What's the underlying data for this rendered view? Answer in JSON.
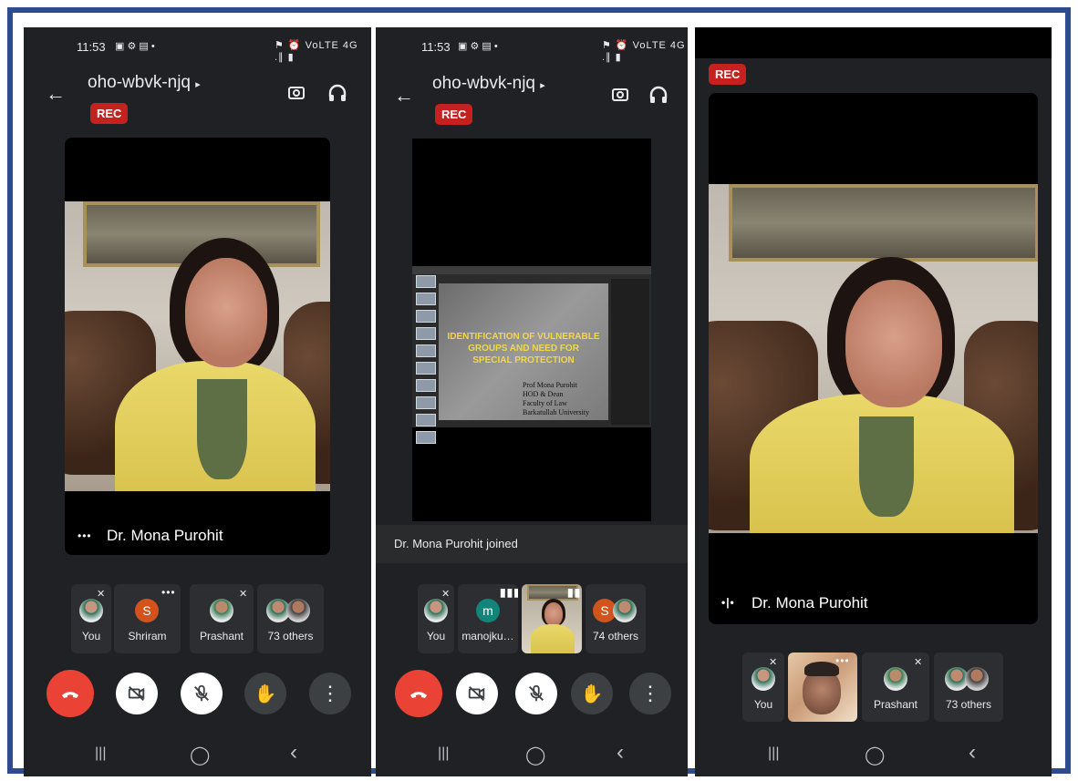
{
  "status": {
    "time": "11:53",
    "left_icons": "▣ ⚙ ▤ •",
    "right_icons": "⚑ ⏰ VoLTE 4G .∥ ▮"
  },
  "meeting": {
    "code": "oho-wbvk-njq",
    "rec_label": "REC"
  },
  "speaker": {
    "name": "Dr. Mona Purohit"
  },
  "panel2": {
    "toast": "Dr. Mona Purohit joined",
    "slide": {
      "title_lines": [
        "IDENTIFICATION OF VULNERABLE",
        "GROUPS AND NEED FOR",
        "SPECIAL PROTECTION"
      ],
      "author_lines": [
        "Prof Mona Purohit",
        "HOD & Dean",
        "Faculty of Law",
        "Barkatullah University"
      ]
    }
  },
  "participants": {
    "panel1": [
      {
        "label": "You"
      },
      {
        "label": "Shriram",
        "initial": "S"
      },
      {
        "label": "Prashant"
      },
      {
        "label": "73 others"
      }
    ],
    "panel2": [
      {
        "label": "You"
      },
      {
        "label": "manojku…",
        "initial": "m"
      },
      {
        "label": "74 others",
        "initial": "S"
      }
    ],
    "panel3": [
      {
        "label": "You"
      },
      {
        "label": "Prashant"
      },
      {
        "label": "73 others"
      }
    ]
  },
  "icons": {
    "back": "←",
    "camera_switch": "⟲",
    "audio": "∩",
    "end_call": "☎",
    "camera_off": "▧",
    "mic_off": "✕",
    "hand": "✋",
    "more": "⋮",
    "nav_recent": "|||",
    "nav_home": "◯",
    "nav_back": "‹",
    "speaking": "•|•",
    "tile_more": "•••"
  },
  "colors": {
    "rec": "#c5221f",
    "end_call": "#ea4335",
    "frame": "#2e4b8f",
    "background": "#202124"
  }
}
